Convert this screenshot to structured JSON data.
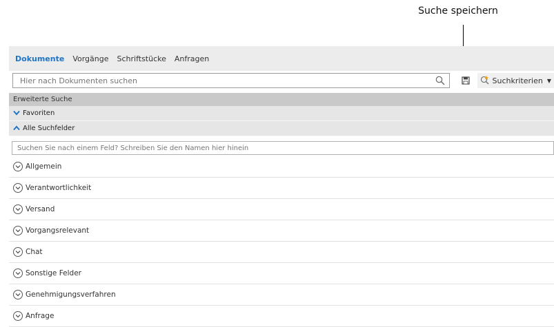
{
  "callout": {
    "label": "Suche speichern"
  },
  "tabs": [
    {
      "label": "Dokumente",
      "active": true
    },
    {
      "label": "Vorgänge",
      "active": false
    },
    {
      "label": "Schriftstücke",
      "active": false
    },
    {
      "label": "Anfragen",
      "active": false
    }
  ],
  "search": {
    "placeholder": "Hier nach Dokumenten suchen",
    "value": "",
    "search_icon": "magnifier-icon",
    "save_icon": "floppy-disk-icon",
    "criteria_label": "Suchkriterien",
    "criteria_icon": "search-plus-icon"
  },
  "advanced": {
    "header": "Erweiterte Suche",
    "favorites_label": "Favoriten",
    "all_fields_label": "Alle Suchfelder",
    "field_search_placeholder": "Suchen Sie nach einem Feld? Schreiben Sie den Namen hier hinein"
  },
  "fields": [
    {
      "label": "Allgemein"
    },
    {
      "label": "Verantwortlichkeit"
    },
    {
      "label": "Versand"
    },
    {
      "label": "Vorgangsrelevant"
    },
    {
      "label": "Chat"
    },
    {
      "label": "Sonstige Felder"
    },
    {
      "label": "Genehmigungsverfahren"
    },
    {
      "label": "Anfrage"
    }
  ],
  "colors": {
    "accent": "#1f74c6",
    "tabbar_bg": "#ececec",
    "section_bg": "#c9c9c9",
    "group_bg": "#e6e6e6"
  }
}
